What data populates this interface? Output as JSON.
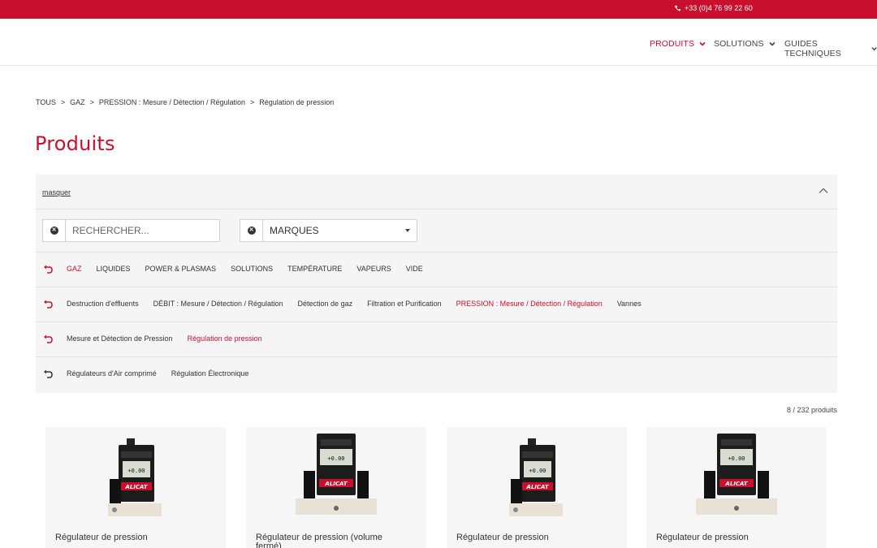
{
  "topbar": {
    "phone": "+33 (0)4 76 99 22 60",
    "color": "#c8102e"
  },
  "nav": [
    {
      "label": "PRODUITS",
      "active": true
    },
    {
      "label": "SOLUTIONS",
      "active": false
    },
    {
      "label": "GUIDES TECHNIQUES",
      "active": false
    }
  ],
  "breadcrumb": [
    "TOUS",
    "GAZ",
    "PRESSION : Mesure / Détection / Régulation",
    "Régulation de pression"
  ],
  "page_title": "Produits",
  "filters": {
    "toggle_label": "masquer",
    "search_placeholder": "RECHERCHER...",
    "brands_label": "MARQUES",
    "rows": [
      [
        "GAZ",
        "LIQUIDES",
        "POWER & PLASMAS",
        "SOLUTIONS",
        "TEMPÉRATURE",
        "VAPEURS",
        "VIDE"
      ],
      [
        "Destruction d'effluents",
        "DÉBIT : Mesure / Détection / Régulation",
        "Détection de gaz",
        "Filtration et Purification",
        "PRESSION : Mesure / Détection / Régulation",
        "Vannes"
      ],
      [
        "Mesure et Détection de Pression",
        "Régulation de pression"
      ],
      [
        "Régulateurs d'Air comprimé",
        "Régulation Électronique"
      ]
    ],
    "active": [
      "GAZ",
      "PRESSION : Mesure / Détection / Régulation",
      "Régulation de pression"
    ]
  },
  "results_count": "8 / 232 produits",
  "products": [
    {
      "name": "Régulateur de pression",
      "image": "small-controller",
      "brand_text": "ALICAT",
      "display": "+0.00"
    },
    {
      "name": "Régulateur de pression (volume fermé)",
      "image": "large-controller",
      "brand_text": "ALICAT",
      "display": "+0.00"
    },
    {
      "name": "Régulateur de pression",
      "image": "small-controller",
      "brand_text": "ALICAT",
      "display": "+0.00"
    },
    {
      "name": "Régulateur de pression",
      "image": "large-controller",
      "brand_text": "ALICAT",
      "display": "+0.00"
    }
  ]
}
